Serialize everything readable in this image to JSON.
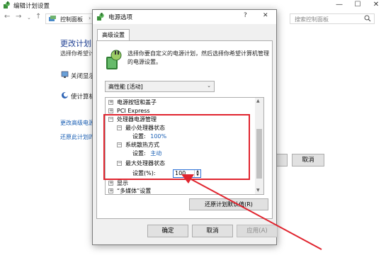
{
  "bg_window": {
    "title": "编辑计划设置",
    "address_crumb": "控制面板",
    "search_placeholder": "搜索控制面板",
    "heading": "更改计划的",
    "subheading": "选择你希望计算机",
    "options": [
      "关闭显示",
      "使计算机"
    ],
    "links": [
      "更改高级电源",
      "还原此计划的"
    ],
    "cancel_button": "取消"
  },
  "dialog": {
    "title": "电源选项",
    "help": "?",
    "close": "✕",
    "tab": "高级设置",
    "description": "选择你要自定义的电源计划，然后选择你希望计算机管理的电源设置。",
    "plan_selected": "高性能 [活动]",
    "tree": [
      {
        "label": "电源按钮和盖子",
        "expander": "+"
      },
      {
        "label": "PCI Express",
        "expander": "+"
      },
      {
        "label": "处理器电源管理",
        "expander": "−"
      },
      {
        "label": "最小处理器状态",
        "expander": "−"
      },
      {
        "label": "设置:",
        "value": "100%"
      },
      {
        "label": "系统散热方式",
        "expander": "−"
      },
      {
        "label": "设置:",
        "value": "主动"
      },
      {
        "label": "最大处理器状态",
        "expander": "−"
      },
      {
        "label": "设置(%):"
      },
      {
        "label": "显示",
        "expander": "+"
      },
      {
        "label": "“多媒体”设置",
        "expander": "+"
      }
    ],
    "max_state_value": "100",
    "restore_button": "还原计划默认值(R)",
    "ok_button": "确定",
    "cancel_button": "取消",
    "apply_button": "应用(A)"
  },
  "colors": {
    "highlight": "#e0242e",
    "link": "#1a5fb4",
    "heading": "#1e3f93"
  }
}
